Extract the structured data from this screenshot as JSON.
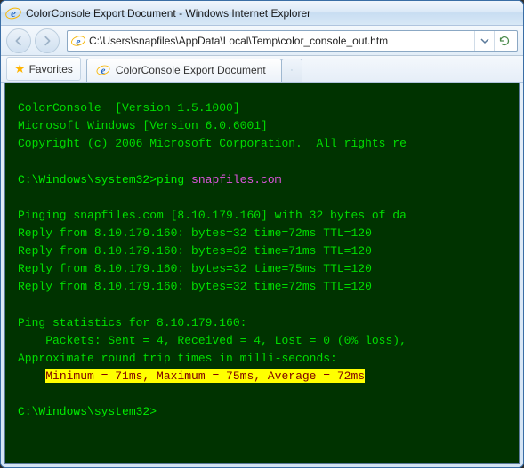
{
  "window": {
    "title": "ColorConsole Export Document - Windows Internet Explorer"
  },
  "address": {
    "path": "C:\\Users\\snapfiles\\AppData\\Local\\Temp\\color_console_out.htm"
  },
  "favorites": {
    "label": "Favorites"
  },
  "tab": {
    "title": "ColorConsole Export Document"
  },
  "console": {
    "banner1": "ColorConsole  [Version 1.5.1000]",
    "banner2": "Microsoft Windows [Version 6.0.6001]",
    "banner3": "Copyright (c) 2006 Microsoft Corporation.  All rights re",
    "prompt1_path": "C:\\Windows\\system32>",
    "prompt1_cmd": "ping ",
    "prompt1_host": "snapfiles.com",
    "ping_header": "Pinging snapfiles.com [8.10.179.160] with 32 bytes of da",
    "reply1": "Reply from 8.10.179.160: bytes=32 time=72ms TTL=120",
    "reply2": "Reply from 8.10.179.160: bytes=32 time=71ms TTL=120",
    "reply3": "Reply from 8.10.179.160: bytes=32 time=75ms TTL=120",
    "reply4": "Reply from 8.10.179.160: bytes=32 time=72ms TTL=120",
    "stats1": "Ping statistics for 8.10.179.160:",
    "stats2": "    Packets: Sent = 4, Received = 4, Lost = 0 (0% loss),",
    "stats3": "Approximate round trip times in milli-seconds:",
    "stats4_prefix": "    ",
    "stats4_hl": "Minimum = 71ms, Maximum = 75ms, Average = 72ms",
    "prompt2_path": "C:\\Windows\\system32>"
  }
}
